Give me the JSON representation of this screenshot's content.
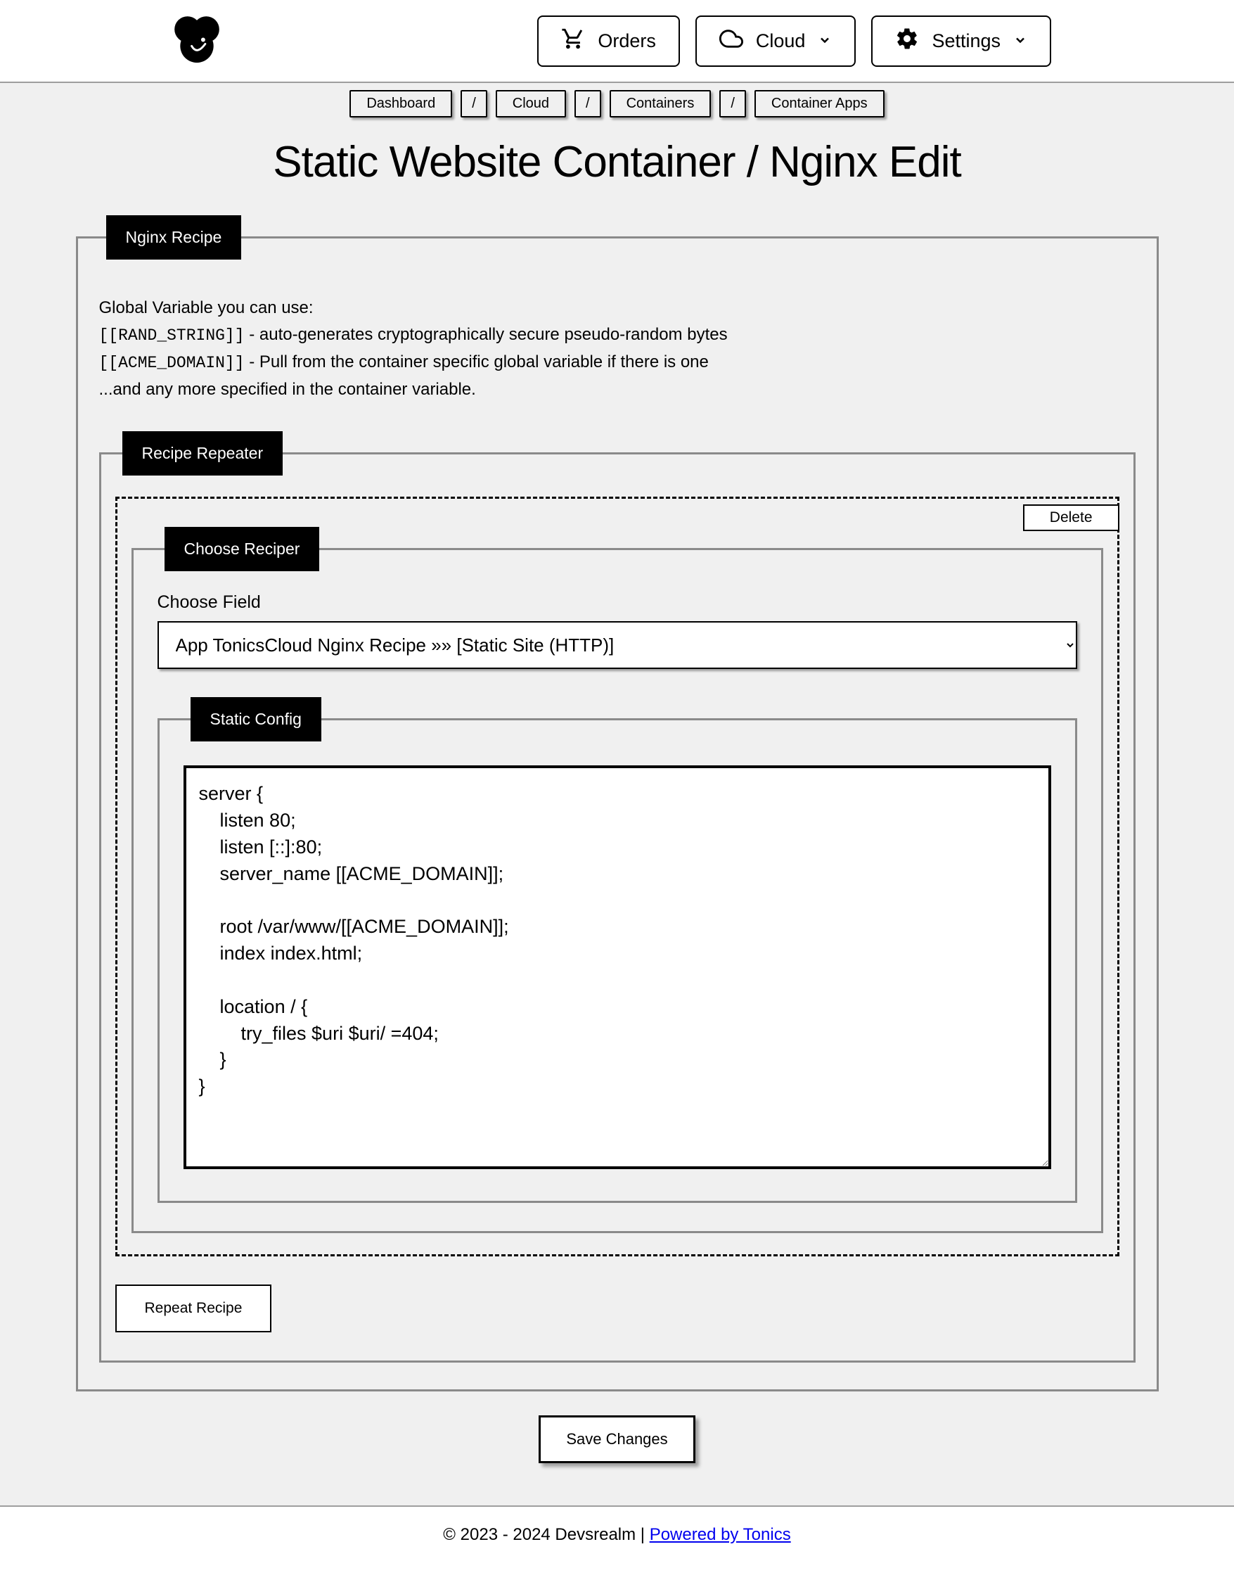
{
  "header": {
    "nav": {
      "orders": "Orders",
      "cloud": "Cloud",
      "settings": "Settings"
    }
  },
  "breadcrumbs": {
    "items": [
      "Dashboard",
      "Cloud",
      "Containers",
      "Container Apps"
    ],
    "sep": "/"
  },
  "page_title": "Static Website Container / Nginx Edit",
  "fieldset": {
    "nginx_recipe_legend": "Nginx Recipe",
    "help_intro": "Global Variable you can use:",
    "help_rand_code": "[[RAND_STRING]]",
    "help_rand_text": " - auto-generates cryptographically secure pseudo-random bytes",
    "help_acme_code": "[[ACME_DOMAIN]]",
    "help_acme_text": " - Pull from the container specific global variable if there is one",
    "help_more": "...and any more specified in the container variable.",
    "repeater_legend": "Recipe Repeater",
    "delete_label": "Delete",
    "choose_reciper_legend": "Choose Reciper",
    "choose_field_label": "Choose Field",
    "select_value": "App TonicsCloud Nginx Recipe »» [Static Site (HTTP)]",
    "static_config_legend": "Static Config",
    "config_text": "server {\n    listen 80;\n    listen [::]:80;\n    server_name [[ACME_DOMAIN]];\n\n    root /var/www/[[ACME_DOMAIN]];\n    index index.html;\n\n    location / {\n        try_files $uri $uri/ =404;\n    }\n}",
    "repeat_label": "Repeat Recipe"
  },
  "save_label": "Save Changes",
  "footer": {
    "copyright": "© 2023 - 2024 Devsrealm | ",
    "link_text": "Powered by Tonics"
  }
}
